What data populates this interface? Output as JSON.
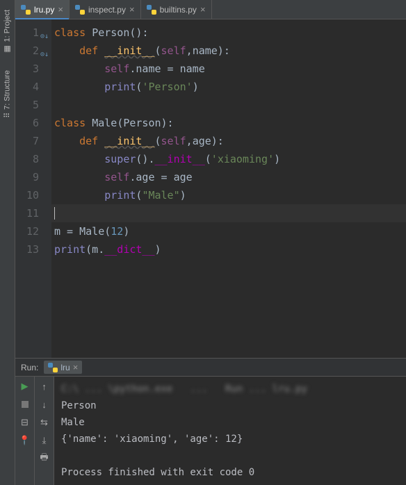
{
  "sidebar": {
    "project": {
      "label": "1: Project",
      "icon": "project-icon"
    },
    "structure": {
      "label": "7: Structure",
      "icon": "structure-icon"
    }
  },
  "tabs": [
    {
      "label": "lru.py",
      "active": true,
      "closable": true
    },
    {
      "label": "inspect.py",
      "active": false,
      "closable": true
    },
    {
      "label": "builtins.py",
      "active": false,
      "closable": true
    }
  ],
  "editor": {
    "filename": "lru.py",
    "language": "python",
    "lines": [
      {
        "n": 1,
        "tokens": [
          [
            "kw",
            "class "
          ],
          [
            "cls",
            "Person"
          ],
          [
            "ident",
            "("
          ],
          [
            "uwave",
            ""
          ],
          [
            "ident",
            ")"
          ],
          [
            "ident",
            ":"
          ]
        ],
        "fold": true,
        "mark": true
      },
      {
        "n": 2,
        "indent": 1,
        "tokens": [
          [
            "kw",
            "def "
          ],
          [
            "fn",
            "__init__"
          ],
          [
            "ident",
            "("
          ],
          [
            "self",
            "self"
          ],
          [
            "ident",
            ","
          ],
          [
            "ident",
            "name):"
          ]
        ],
        "fold": true,
        "mark": true
      },
      {
        "n": 3,
        "indent": 2,
        "tokens": [
          [
            "self",
            "self"
          ],
          [
            "ident",
            ".name = name"
          ]
        ]
      },
      {
        "n": 4,
        "indent": 2,
        "tokens": [
          [
            "builtin",
            "print"
          ],
          [
            "ident",
            "("
          ],
          [
            "str",
            "'Person'"
          ],
          [
            "ident",
            ")"
          ]
        ],
        "foldend": true
      },
      {
        "n": 5,
        "indent": 0,
        "tokens": []
      },
      {
        "n": 6,
        "indent": 0,
        "tokens": [
          [
            "kw",
            "class "
          ],
          [
            "cls",
            "Male"
          ],
          [
            "ident",
            "(Person):"
          ]
        ],
        "fold": true
      },
      {
        "n": 7,
        "indent": 1,
        "tokens": [
          [
            "kw",
            "def "
          ],
          [
            "fn",
            "__init__"
          ],
          [
            "ident",
            "("
          ],
          [
            "self",
            "self"
          ],
          [
            "ident",
            ","
          ],
          [
            "ident",
            "age):"
          ]
        ],
        "fold": true
      },
      {
        "n": 8,
        "indent": 2,
        "tokens": [
          [
            "builtin",
            "super"
          ],
          [
            "ident",
            "()."
          ],
          [
            "dunder",
            "__init__"
          ],
          [
            "ident",
            "("
          ],
          [
            "str",
            "'"
          ],
          [
            "str",
            "xiaoming"
          ],
          [
            "str",
            "'"
          ],
          [
            "ident",
            ")"
          ]
        ]
      },
      {
        "n": 9,
        "indent": 2,
        "tokens": [
          [
            "self",
            "self"
          ],
          [
            "ident",
            ".age = age"
          ]
        ]
      },
      {
        "n": 10,
        "indent": 2,
        "tokens": [
          [
            "builtin",
            "print"
          ],
          [
            "ident",
            "("
          ],
          [
            "str",
            "\"Male\""
          ],
          [
            "ident",
            ")"
          ]
        ],
        "foldend": true
      },
      {
        "n": 11,
        "indent": 0,
        "tokens": [],
        "caret": true,
        "highlight": true
      },
      {
        "n": 12,
        "indent": 0,
        "tokens": [
          [
            "ident",
            "m = Male("
          ],
          [
            "num",
            "12"
          ],
          [
            "ident",
            ")"
          ]
        ],
        "wavy": true
      },
      {
        "n": 13,
        "indent": 0,
        "tokens": [
          [
            "builtin",
            "print"
          ],
          [
            "ident",
            "(m."
          ],
          [
            "dunder",
            "__dict__"
          ],
          [
            "ident",
            ")"
          ]
        ],
        "wavy": true
      }
    ]
  },
  "run": {
    "label": "Run:",
    "tab_label": "lru",
    "output": [
      "",
      "Person",
      "Male",
      "{'name': 'xiaoming', 'age': 12}",
      "",
      "Process finished with exit code 0"
    ],
    "blurred_first_line": "C:\\ ... \\python.exe   ...   Run ... lru.py"
  },
  "icons": {
    "play": "▶",
    "stop": "■",
    "pin": "📌",
    "up": "↑",
    "down": "↓",
    "wrap": "⇆",
    "scroll": "⤓",
    "print": "🖶",
    "layout": "⊟"
  }
}
